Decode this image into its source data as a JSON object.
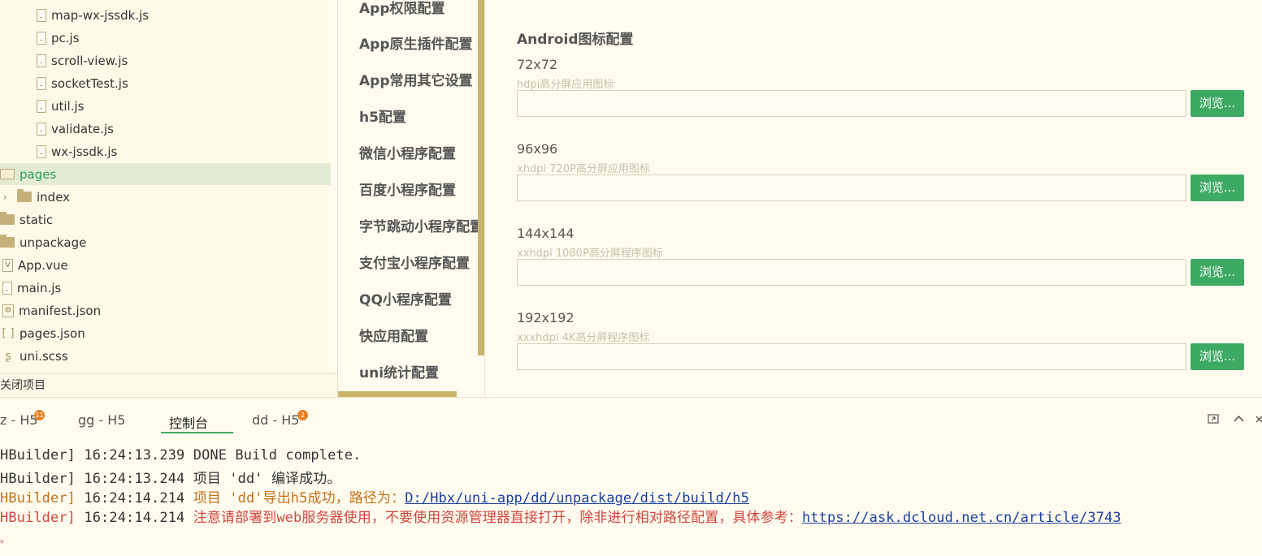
{
  "file_tree": {
    "items": [
      {
        "label": "map-wx-jssdk.js",
        "icon": "js-file-icon"
      },
      {
        "label": "pc.js",
        "icon": "js-file-icon"
      },
      {
        "label": "scroll-view.js",
        "icon": "js-file-icon"
      },
      {
        "label": "socketTest.js",
        "icon": "js-file-icon"
      },
      {
        "label": "util.js",
        "icon": "js-file-icon"
      },
      {
        "label": "validate.js",
        "icon": "js-file-icon"
      },
      {
        "label": "wx-jssdk.js",
        "icon": "js-file-icon"
      },
      {
        "label": "pages",
        "icon": "folder-open-icon",
        "selected": true
      },
      {
        "label": "index",
        "icon": "folder-icon"
      },
      {
        "label": "static",
        "icon": "folder-icon"
      },
      {
        "label": "unpackage",
        "icon": "folder-icon"
      },
      {
        "label": "App.vue",
        "icon": "vue-file-icon"
      },
      {
        "label": "main.js",
        "icon": "js-file-icon"
      },
      {
        "label": "manifest.json",
        "icon": "manifest-file-icon"
      },
      {
        "label": "pages.json",
        "icon": "json-file-icon"
      },
      {
        "label": "uni.scss",
        "icon": "scss-file-icon"
      }
    ],
    "close_project": "关闭项目"
  },
  "settings_nav": {
    "items": [
      "App权限配置",
      "App原生插件配置",
      "App常用其它设置",
      "h5配置",
      "微信小程序配置",
      "百度小程序配置",
      "字节跳动小程序配置",
      "支付宝小程序配置",
      "QQ小程序配置",
      "快应用配置",
      "uni统计配置"
    ]
  },
  "icon_config": {
    "title": "Android图标配置",
    "browse_label": "浏览...",
    "icons": [
      {
        "size": "72x72",
        "hint": "hdpi高分屏应用图标",
        "value": ""
      },
      {
        "size": "96x96",
        "hint": "xhdpi 720P高分屏应用图标",
        "value": ""
      },
      {
        "size": "144x144",
        "hint": "xxhdpi 1080P高分屏程序图标",
        "value": ""
      },
      {
        "size": "192x192",
        "hint": "xxxhdpi 4K高分屏程序图标",
        "value": ""
      }
    ]
  },
  "console": {
    "tabs": [
      {
        "label": "z - H5",
        "badge": "11"
      },
      {
        "label": "gg - H5",
        "badge": ""
      },
      {
        "label": "控制台",
        "badge": "",
        "active": true
      },
      {
        "label": "dd - H5",
        "badge": "2"
      }
    ],
    "logs": [
      {
        "prefix": "HBuilder]",
        "time": "16:24:13.239",
        "message": " DONE  Build complete.",
        "link": "",
        "level": "plain"
      },
      {
        "prefix": "HBuilder]",
        "time": "16:24:13.244",
        "message": "项目 'dd' 编译成功。",
        "link": "",
        "level": "plain"
      },
      {
        "prefix": "HBuilder]",
        "time": "16:24:14.214",
        "message": "项目 'dd'导出h5成功，路径为：",
        "link": "D:/Hbx/uni-app/dd/unpackage/dist/build/h5",
        "level": "warn"
      },
      {
        "prefix": "HBuilder]",
        "time": "16:24:14.214",
        "message": "注意请部署到web服务器使用，不要使用资源管理器直接打开，除非进行相对路径配置，具体参考：",
        "link": "https://ask.dcloud.net.cn/article/3743",
        "level": "err"
      }
    ],
    "trailing": "。"
  },
  "colors": {
    "accent_green": "#3daa63",
    "scrollbar": "#c9b46a",
    "badge_orange": "#e67e22"
  }
}
